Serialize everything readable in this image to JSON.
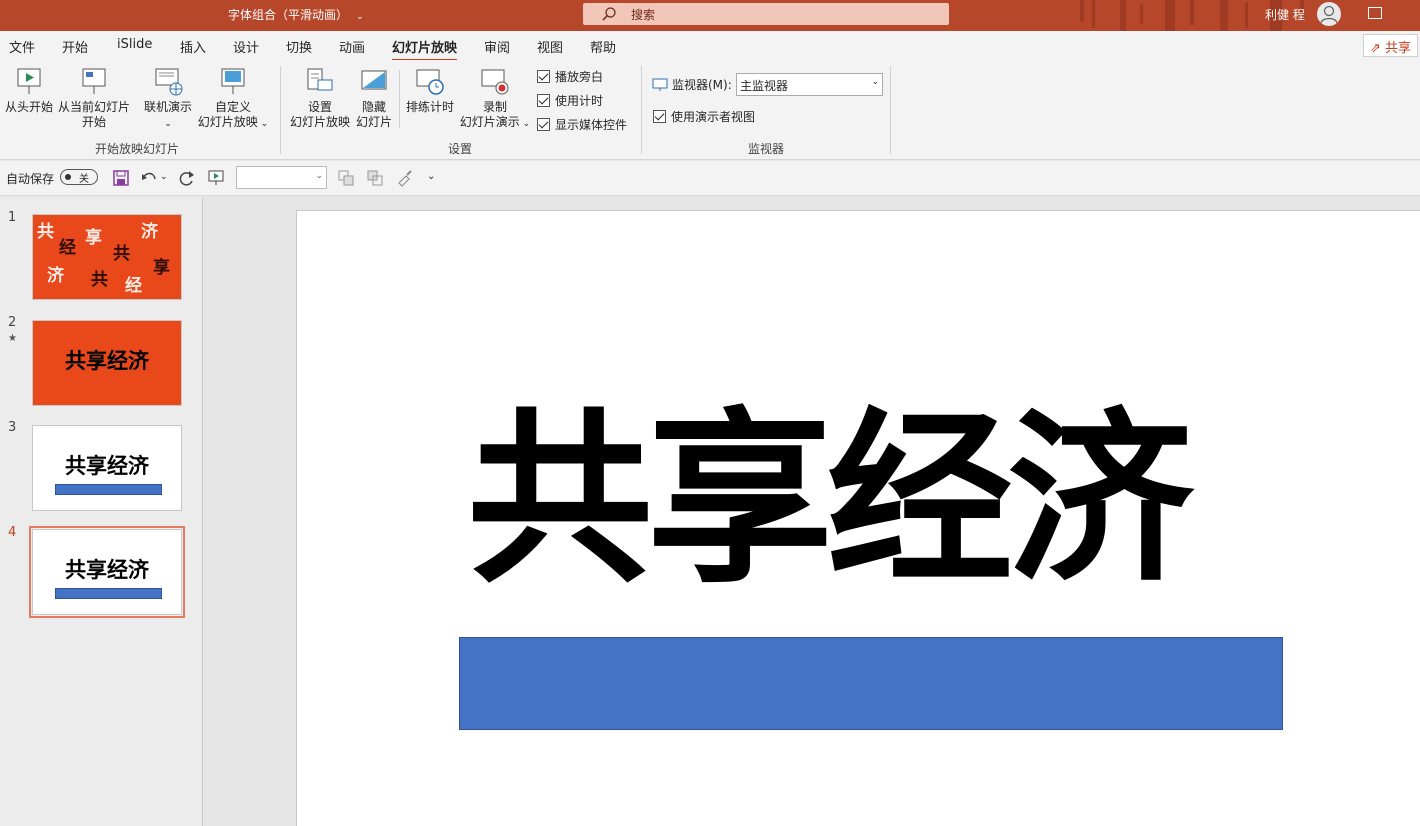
{
  "titlebar": {
    "doc_title": "字体组合（平滑动画）",
    "doc_caret": "⌄",
    "search_placeholder": "搜索",
    "username": "利健 程"
  },
  "menu": {
    "tabs": [
      "文件",
      "开始",
      "iSlide",
      "插入",
      "设计",
      "切换",
      "动画",
      "幻灯片放映",
      "审阅",
      "视图",
      "帮助"
    ],
    "active_tab": "幻灯片放映",
    "share_label": "共享"
  },
  "ribbon": {
    "start_group": {
      "label": "开始放映幻灯片",
      "from_beginning": "从头开始",
      "from_current_line1": "从当前幻灯片",
      "from_current_line2": "开始",
      "online_present": "联机演示",
      "custom_line1": "自定义",
      "custom_line2": "幻灯片放映"
    },
    "setup_group": {
      "label": "设置",
      "setup_line1": "设置",
      "setup_line2": "幻灯片放映",
      "hide_line1": "隐藏",
      "hide_line2": "幻灯片",
      "rehearse": "排练计时",
      "record_line1": "录制",
      "record_line2": "幻灯片演示",
      "check_narration": "播放旁白",
      "check_timings": "使用计时",
      "check_media": "显示媒体控件"
    },
    "monitor_group": {
      "label": "监视器",
      "monitor_label": "监视器(M):",
      "monitor_value": "主监视器",
      "presenter_view": "使用演示者视图"
    }
  },
  "qat": {
    "autosave_label": "自动保存",
    "autosave_state": "关"
  },
  "thumbnails": [
    {
      "number": "1",
      "style": "orange-scatter"
    },
    {
      "number": "2",
      "star": "★",
      "style": "orange-title",
      "title": "共享经济"
    },
    {
      "number": "3",
      "style": "white-title-bar",
      "title": "共享经济"
    },
    {
      "number": "4",
      "style": "white-title-bar",
      "title": "共享经济",
      "selected": true
    }
  ],
  "slide": {
    "title": "共享经济"
  },
  "colors": {
    "titlebar": "#b7472a",
    "accent": "#c43e1c",
    "slide_orange": "#e9481b",
    "bar_blue": "#4472c4"
  }
}
